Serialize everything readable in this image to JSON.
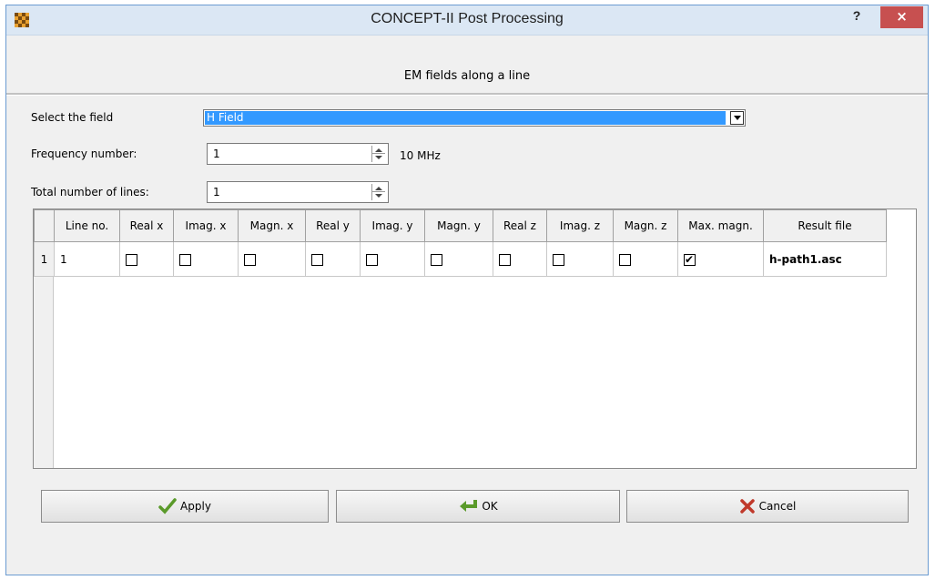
{
  "window": {
    "title": "CONCEPT-II Post Processing",
    "help": "?",
    "close": "×"
  },
  "heading": "EM fields along a line",
  "form": {
    "select_field_label": "Select the field",
    "select_field_value": "H Field",
    "frequency_label": "Frequency number:",
    "frequency_value": "1",
    "frequency_unit": "10 MHz",
    "lines_label": "Total number of lines:",
    "lines_value": "1"
  },
  "table": {
    "columns": [
      "Line no.",
      "Real x",
      "Imag. x",
      "Magn. x",
      "Real y",
      "Imag. y",
      "Magn. y",
      "Real z",
      "Imag. z",
      "Magn. z",
      "Max. magn.",
      "Result file"
    ],
    "rows": [
      {
        "row_number": "1",
        "line_no": "1",
        "checks": [
          false,
          false,
          false,
          false,
          false,
          false,
          false,
          false,
          false,
          true
        ],
        "result_file": "h-path1.asc"
      }
    ]
  },
  "buttons": {
    "apply": "Apply",
    "ok": "OK",
    "cancel": "Cancel"
  },
  "icons": {
    "app": "checkerboard-icon",
    "apply": "checkmark-icon",
    "ok": "return-arrow-icon",
    "cancel": "x-icon"
  },
  "colors": {
    "selection": "#3399ff",
    "close_button": "#c75050",
    "apply_icon": "#5a9a2a",
    "ok_icon": "#5a9a2a",
    "cancel_icon": "#c0392b"
  }
}
